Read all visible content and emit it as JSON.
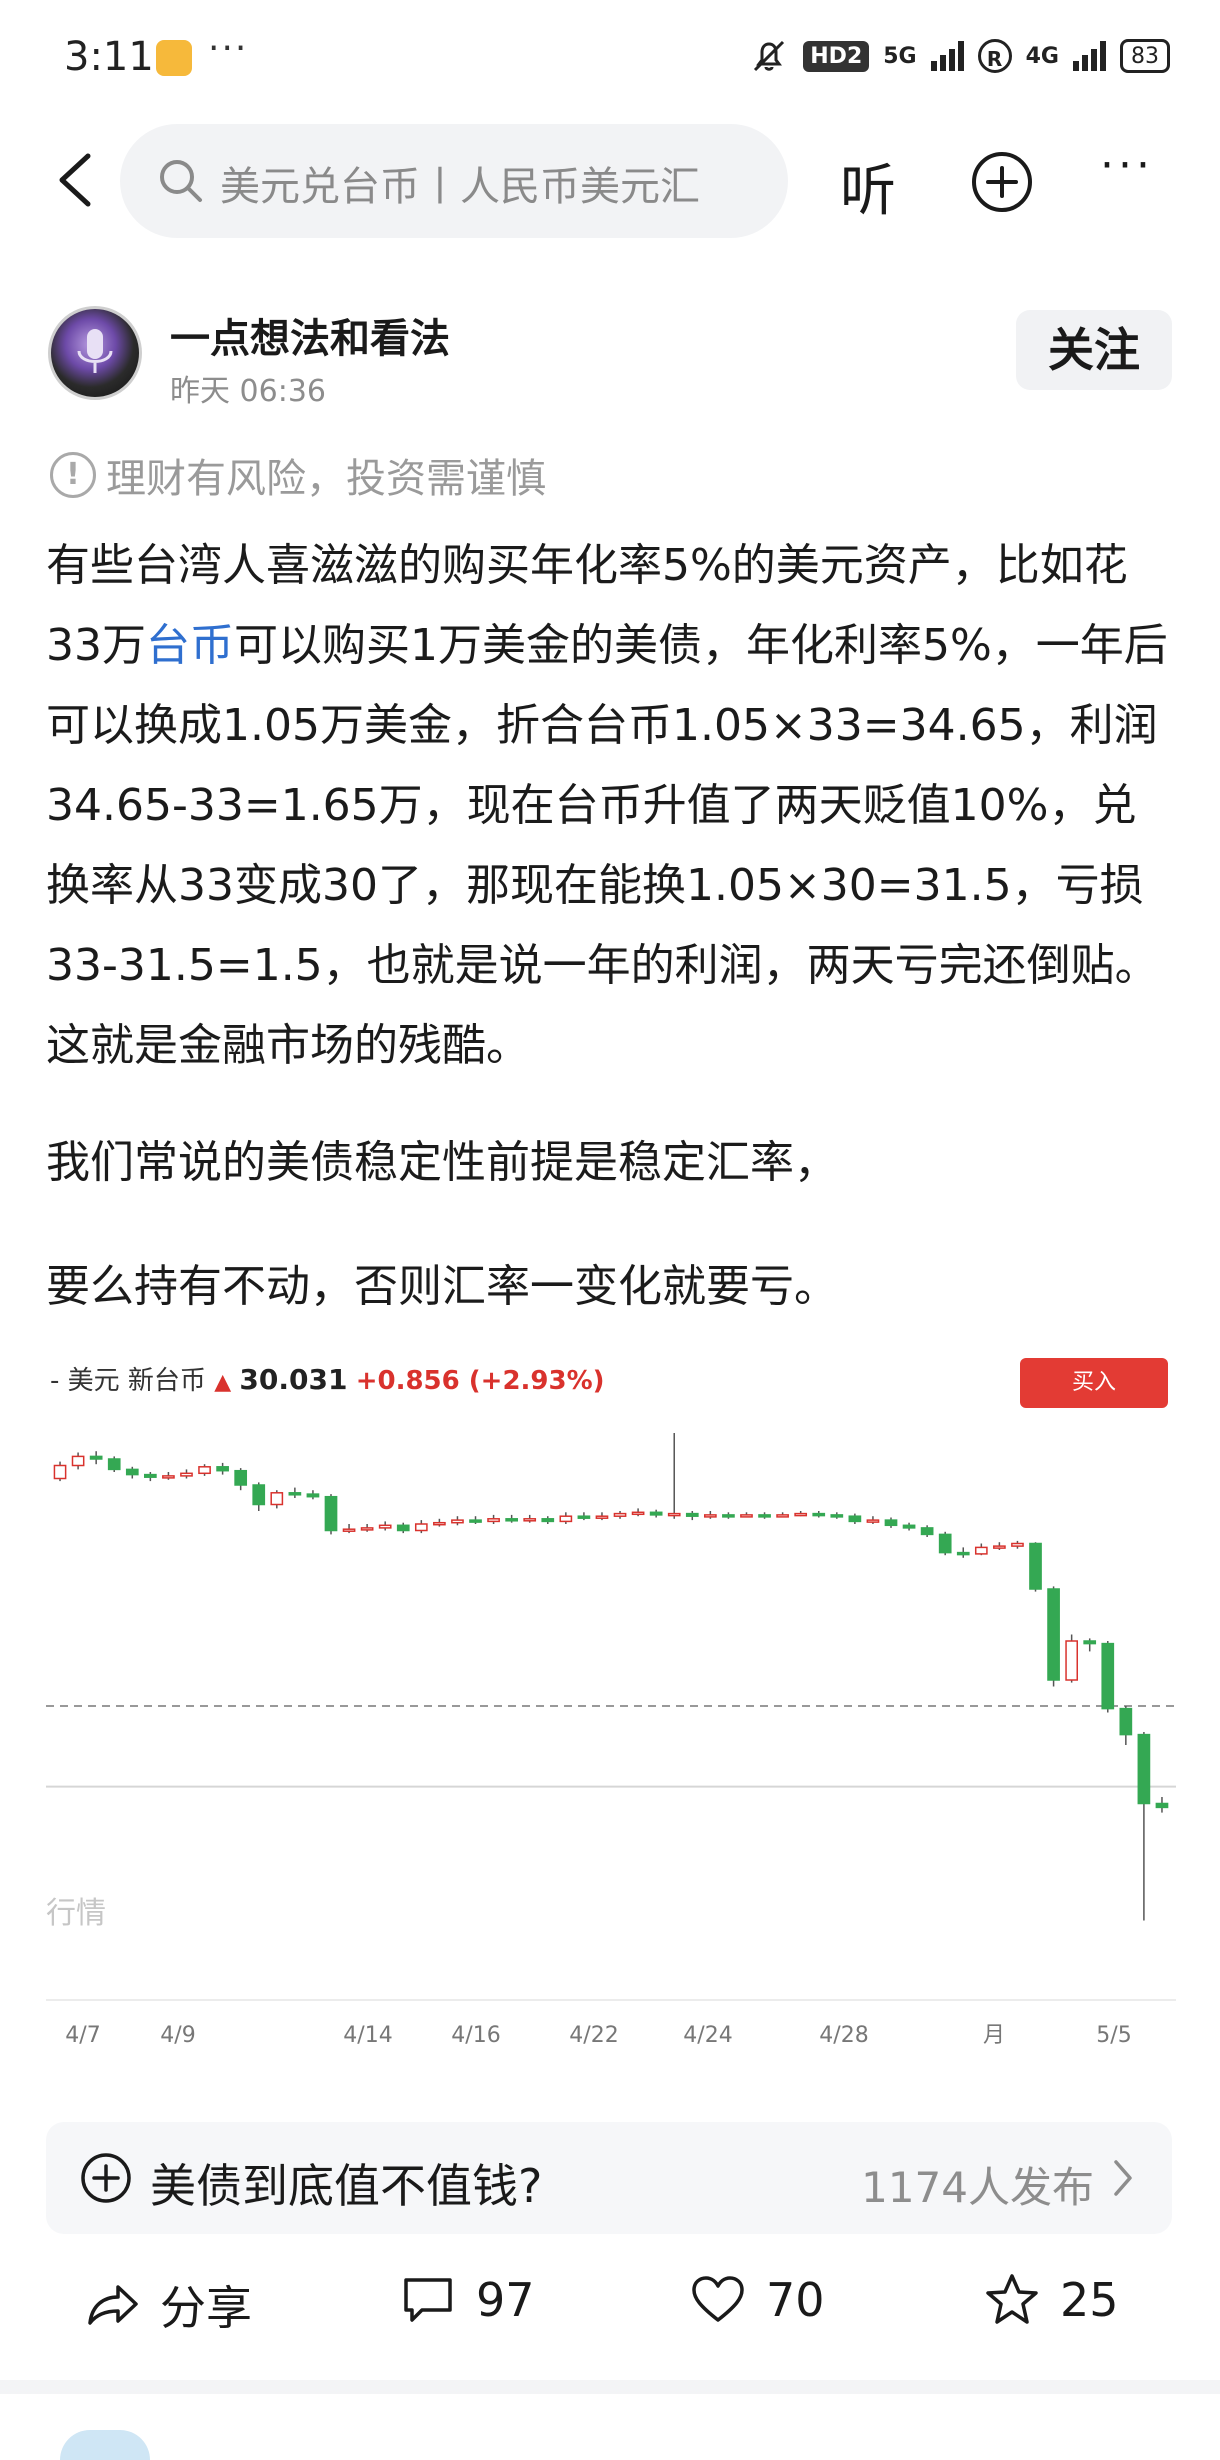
{
  "status_bar": {
    "time": "3:11",
    "dots": "···",
    "hd": "HD2",
    "net1": "5G",
    "net2": "4G",
    "battery": "83"
  },
  "nav": {
    "search_placeholder": "美元兑台币丨人民币美元汇",
    "listen_label": "听",
    "more_label": "···"
  },
  "author": {
    "name": "一点想法和看法",
    "post_time": "昨天  06:36",
    "follow_label": "关注"
  },
  "risk_notice": "理财有风险，投资需谨慎",
  "article": {
    "p1_a": "有些台湾人喜滋滋的购买年化率5%的美元资产，比如花33万",
    "p1_link": "台币",
    "p1_b": "可以购买1万美金的美债，年化利率5%，一年后可以换成1.05万美金，折合台币1.05×33=34.65，利润34.65-33=1.65万，现在台币升值了两天贬值10%，兑换率从33变成30了，那现在能换1.05×30=31.5，亏损33-31.5=1.5，也就是说一年的利润，两天亏完还倒贴。这就是金融市场的残酷。",
    "p2": "我们常说的美债稳定性前提是稳定汇率，",
    "p3": "要么持有不动，否则汇率一变化就要亏。"
  },
  "chart_header": {
    "pair": "- 美元 新台币",
    "price": "30.031",
    "change": "+0.856 (+2.93%)",
    "buy_label": "买入",
    "watermark": "行情"
  },
  "chart_data": {
    "type": "candlestick",
    "x_tick_labels": [
      "4/7",
      "4/9",
      "4/14",
      "4/16",
      "4/22",
      "4/24",
      "4/28",
      "月",
      "5/5"
    ],
    "series": [
      {
        "values": [
          [
            32.95,
            33.05,
            33.08,
            32.93
          ],
          [
            33.05,
            33.12,
            33.15,
            33.02
          ],
          [
            33.12,
            33.1,
            33.16,
            33.06
          ],
          [
            33.1,
            33.02,
            33.12,
            33.0
          ],
          [
            33.02,
            32.98,
            33.04,
            32.95
          ],
          [
            32.98,
            32.96,
            33.0,
            32.93
          ],
          [
            32.96,
            32.97,
            33.0,
            32.94
          ],
          [
            32.97,
            32.99,
            33.02,
            32.95
          ],
          [
            32.99,
            33.04,
            33.06,
            32.97
          ],
          [
            33.04,
            33.01,
            33.07,
            32.98
          ],
          [
            33.01,
            32.9,
            33.03,
            32.86
          ],
          [
            32.9,
            32.75,
            32.92,
            32.7
          ],
          [
            32.75,
            32.84,
            32.86,
            32.72
          ],
          [
            32.84,
            32.83,
            32.88,
            32.8
          ],
          [
            32.83,
            32.81,
            32.86,
            32.79
          ],
          [
            32.81,
            32.55,
            32.83,
            32.52
          ],
          [
            32.55,
            32.56,
            32.6,
            32.53
          ],
          [
            32.56,
            32.57,
            32.6,
            32.54
          ],
          [
            32.57,
            32.59,
            32.62,
            32.55
          ],
          [
            32.59,
            32.55,
            32.61,
            32.53
          ],
          [
            32.55,
            32.6,
            32.63,
            32.53
          ],
          [
            32.6,
            32.61,
            32.64,
            32.58
          ],
          [
            32.61,
            32.63,
            32.66,
            32.59
          ],
          [
            32.63,
            32.62,
            32.66,
            32.6
          ],
          [
            32.62,
            32.64,
            32.67,
            32.6
          ],
          [
            32.64,
            32.63,
            32.67,
            32.61
          ],
          [
            32.63,
            32.64,
            32.67,
            32.61
          ],
          [
            32.64,
            32.62,
            32.66,
            32.6
          ],
          [
            32.62,
            32.66,
            32.69,
            32.6
          ],
          [
            32.66,
            32.65,
            32.69,
            32.63
          ],
          [
            32.65,
            32.66,
            32.69,
            32.63
          ],
          [
            32.66,
            32.68,
            32.7,
            32.64
          ],
          [
            32.68,
            32.69,
            32.72,
            32.66
          ],
          [
            32.69,
            32.67,
            32.71,
            32.65
          ],
          [
            32.67,
            32.68,
            33.3,
            32.64
          ],
          [
            32.68,
            32.66,
            32.7,
            32.63
          ],
          [
            32.66,
            32.67,
            32.7,
            32.64
          ],
          [
            32.67,
            32.66,
            32.69,
            32.64
          ],
          [
            32.66,
            32.67,
            32.69,
            32.65
          ],
          [
            32.67,
            32.66,
            32.69,
            32.64
          ],
          [
            32.66,
            32.67,
            32.69,
            32.65
          ],
          [
            32.67,
            32.68,
            32.7,
            32.66
          ],
          [
            32.68,
            32.67,
            32.7,
            32.65
          ],
          [
            32.67,
            32.66,
            32.69,
            32.64
          ],
          [
            32.66,
            32.62,
            32.68,
            32.6
          ],
          [
            32.62,
            32.63,
            32.66,
            32.6
          ],
          [
            32.63,
            32.59,
            32.65,
            32.57
          ],
          [
            32.59,
            32.57,
            32.61,
            32.55
          ],
          [
            32.57,
            32.52,
            32.59,
            32.5
          ],
          [
            32.52,
            32.38,
            32.54,
            32.36
          ],
          [
            32.38,
            32.37,
            32.42,
            32.34
          ],
          [
            32.37,
            32.42,
            32.45,
            32.36
          ],
          [
            32.42,
            32.43,
            32.46,
            32.4
          ],
          [
            32.43,
            32.45,
            32.47,
            32.41
          ],
          [
            32.45,
            32.1,
            32.46,
            32.08
          ],
          [
            32.1,
            31.4,
            32.12,
            31.35
          ],
          [
            31.4,
            31.7,
            31.75,
            31.38
          ],
          [
            31.7,
            31.68,
            31.72,
            31.62
          ],
          [
            31.68,
            31.18,
            31.7,
            31.15
          ],
          [
            31.18,
            30.98,
            31.2,
            30.9
          ],
          [
            30.98,
            30.45,
            31.0,
            29.55
          ],
          [
            30.45,
            30.42,
            30.5,
            30.38
          ]
        ]
      }
    ],
    "reference_lines": [
      "dashed",
      "solid"
    ]
  },
  "topic": {
    "title": "美债到底值不值钱?",
    "count": "1174人发布"
  },
  "actions": {
    "share_label": "分享",
    "comments": "97",
    "likes": "70",
    "favorites": "25"
  }
}
